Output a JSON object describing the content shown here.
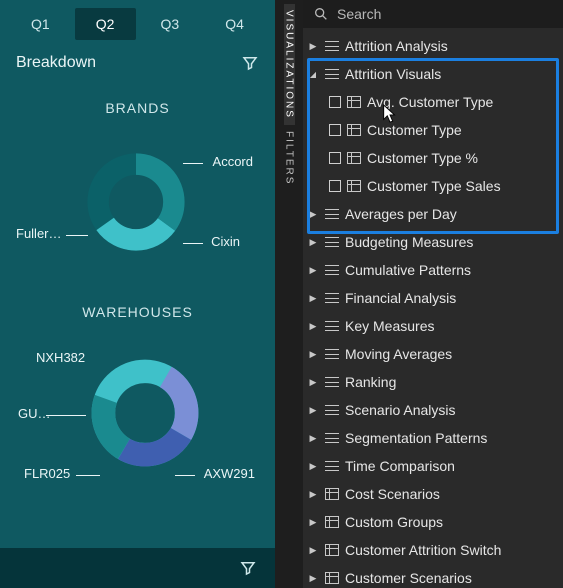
{
  "tabs": [
    "Q1",
    "Q2",
    "Q3",
    "Q4"
  ],
  "tab_active": 1,
  "breakdown_label": "Breakdown",
  "section_brands": "BRANDS",
  "section_warehouses": "WAREHOUSES",
  "brands": {
    "labels": [
      "Accord",
      "Cixin",
      "Fuller…"
    ]
  },
  "warehouses": {
    "labels": [
      "NXH382",
      "GU…",
      "FLR025",
      "AXW291"
    ]
  },
  "rail": {
    "visualizations": "VISUALIZATIONS",
    "filters": "FILTERS"
  },
  "search_placeholder": "Search",
  "tree": [
    {
      "label": "Attrition Analysis",
      "type": "text",
      "expand": "collapsed"
    },
    {
      "label": "Attrition Visuals",
      "type": "text",
      "expand": "expanded",
      "children": [
        {
          "label": "Avg. Customer Type"
        },
        {
          "label": "Customer Type"
        },
        {
          "label": "Customer Type %"
        },
        {
          "label": "Customer Type Sales"
        }
      ]
    },
    {
      "label": "Averages per Day",
      "type": "text",
      "expand": "collapsed"
    },
    {
      "label": "Budgeting Measures",
      "type": "text",
      "expand": "collapsed"
    },
    {
      "label": "Cumulative Patterns",
      "type": "text",
      "expand": "collapsed"
    },
    {
      "label": "Financial Analysis",
      "type": "text",
      "expand": "collapsed"
    },
    {
      "label": "Key Measures",
      "type": "text",
      "expand": "collapsed"
    },
    {
      "label": "Moving Averages",
      "type": "text",
      "expand": "collapsed"
    },
    {
      "label": "Ranking",
      "type": "text",
      "expand": "collapsed"
    },
    {
      "label": "Scenario Analysis",
      "type": "text",
      "expand": "collapsed"
    },
    {
      "label": "Segmentation Patterns",
      "type": "text",
      "expand": "collapsed"
    },
    {
      "label": "Time Comparison",
      "type": "text",
      "expand": "collapsed"
    },
    {
      "label": "Cost Scenarios",
      "type": "table",
      "expand": "collapsed"
    },
    {
      "label": "Custom Groups",
      "type": "table",
      "expand": "collapsed"
    },
    {
      "label": "Customer Attrition Switch",
      "type": "table",
      "expand": "collapsed"
    },
    {
      "label": "Customer Scenarios",
      "type": "table",
      "expand": "collapsed"
    }
  ],
  "highlight_rows": 6,
  "chart_data": [
    {
      "type": "pie",
      "title": "BRANDS",
      "series": [
        {
          "name": "Accord",
          "value": 35,
          "color": "#1a8a8f"
        },
        {
          "name": "Cixin",
          "value": 30,
          "color": "#3fc1c9"
        },
        {
          "name": "Fuller…",
          "value": 35,
          "color": "#0b6168"
        }
      ]
    },
    {
      "type": "pie",
      "title": "WAREHOUSES",
      "series": [
        {
          "name": "NXH382",
          "value": 25,
          "color": "#7b8fd6"
        },
        {
          "name": "AXW291",
          "value": 25,
          "color": "#3f5fb0"
        },
        {
          "name": "FLR025",
          "value": 22,
          "color": "#1a8a8f"
        },
        {
          "name": "GU…",
          "value": 28,
          "color": "#3fc1c9"
        }
      ]
    }
  ]
}
